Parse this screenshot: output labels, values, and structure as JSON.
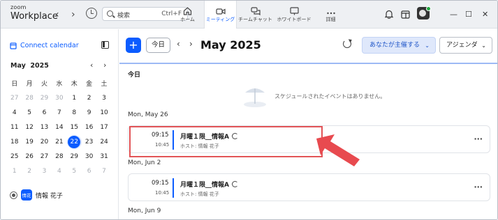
{
  "app": {
    "logo_line1": "zoom",
    "logo_line2": "Workplace"
  },
  "topbar": {
    "search_placeholder": "検索",
    "search_shortcut": "Ctrl+F",
    "tabs": [
      {
        "label": "ホーム",
        "icon": "home-icon",
        "active": false
      },
      {
        "label": "ミーティング",
        "icon": "video-icon",
        "active": true
      },
      {
        "label": "チームチャット",
        "icon": "chat-icon",
        "active": false
      },
      {
        "label": "ホワイトボード",
        "icon": "whiteboard-icon",
        "active": false
      },
      {
        "label": "詳細",
        "icon": "more-icon",
        "active": false
      }
    ],
    "window_min": "—",
    "window_max": "☐",
    "window_close": "✕"
  },
  "sidebar": {
    "connect_calendar": "Connect calendar",
    "month_label": "May",
    "year_label": "2025",
    "weekdays": [
      "日",
      "月",
      "火",
      "水",
      "木",
      "金",
      "土"
    ],
    "weeks": [
      [
        {
          "d": "27",
          "m": true
        },
        {
          "d": "28",
          "m": true
        },
        {
          "d": "29",
          "m": true
        },
        {
          "d": "30",
          "m": true
        },
        {
          "d": "1"
        },
        {
          "d": "2"
        },
        {
          "d": "3"
        }
      ],
      [
        {
          "d": "4"
        },
        {
          "d": "5"
        },
        {
          "d": "6"
        },
        {
          "d": "7"
        },
        {
          "d": "8"
        },
        {
          "d": "9"
        },
        {
          "d": "10"
        }
      ],
      [
        {
          "d": "11"
        },
        {
          "d": "12"
        },
        {
          "d": "13"
        },
        {
          "d": "14"
        },
        {
          "d": "15"
        },
        {
          "d": "16"
        },
        {
          "d": "17"
        }
      ],
      [
        {
          "d": "18"
        },
        {
          "d": "19"
        },
        {
          "d": "20"
        },
        {
          "d": "21"
        },
        {
          "d": "22",
          "today": true
        },
        {
          "d": "23"
        },
        {
          "d": "24"
        }
      ],
      [
        {
          "d": "25"
        },
        {
          "d": "26"
        },
        {
          "d": "27"
        },
        {
          "d": "28"
        },
        {
          "d": "29"
        },
        {
          "d": "30"
        },
        {
          "d": "31"
        }
      ],
      [
        {
          "d": "1",
          "m": true
        },
        {
          "d": "2",
          "m": true
        },
        {
          "d": "3",
          "m": true
        },
        {
          "d": "4",
          "m": true
        },
        {
          "d": "5",
          "m": true
        },
        {
          "d": "6",
          "m": true
        },
        {
          "d": "7",
          "m": true
        }
      ]
    ],
    "user_badge": "情花",
    "user_name": "情報 花子"
  },
  "main": {
    "new_button": "+",
    "today_button": "今日",
    "prev": "‹",
    "next": "›",
    "month_title": "May 2025",
    "host_filter": "あなたが主催する",
    "view_select": "アジェンダ",
    "today_heading": "今日",
    "no_events": "スケジュールされたイベントはありません。",
    "days": [
      {
        "heading": "Mon, May 26",
        "event": {
          "start": "09:15",
          "end": "10:45",
          "title": "月曜１限__情報A",
          "host": "ホスト: 情報 花子"
        }
      },
      {
        "heading": "Mon, Jun 2",
        "event": {
          "start": "09:15",
          "end": "10:45",
          "title": "月曜１限__情報A",
          "host": "ホスト: 情報 花子"
        }
      },
      {
        "heading": "Mon, Jun 9"
      }
    ]
  },
  "colors": {
    "accent": "#0b5cff",
    "highlight": "#e25457"
  }
}
